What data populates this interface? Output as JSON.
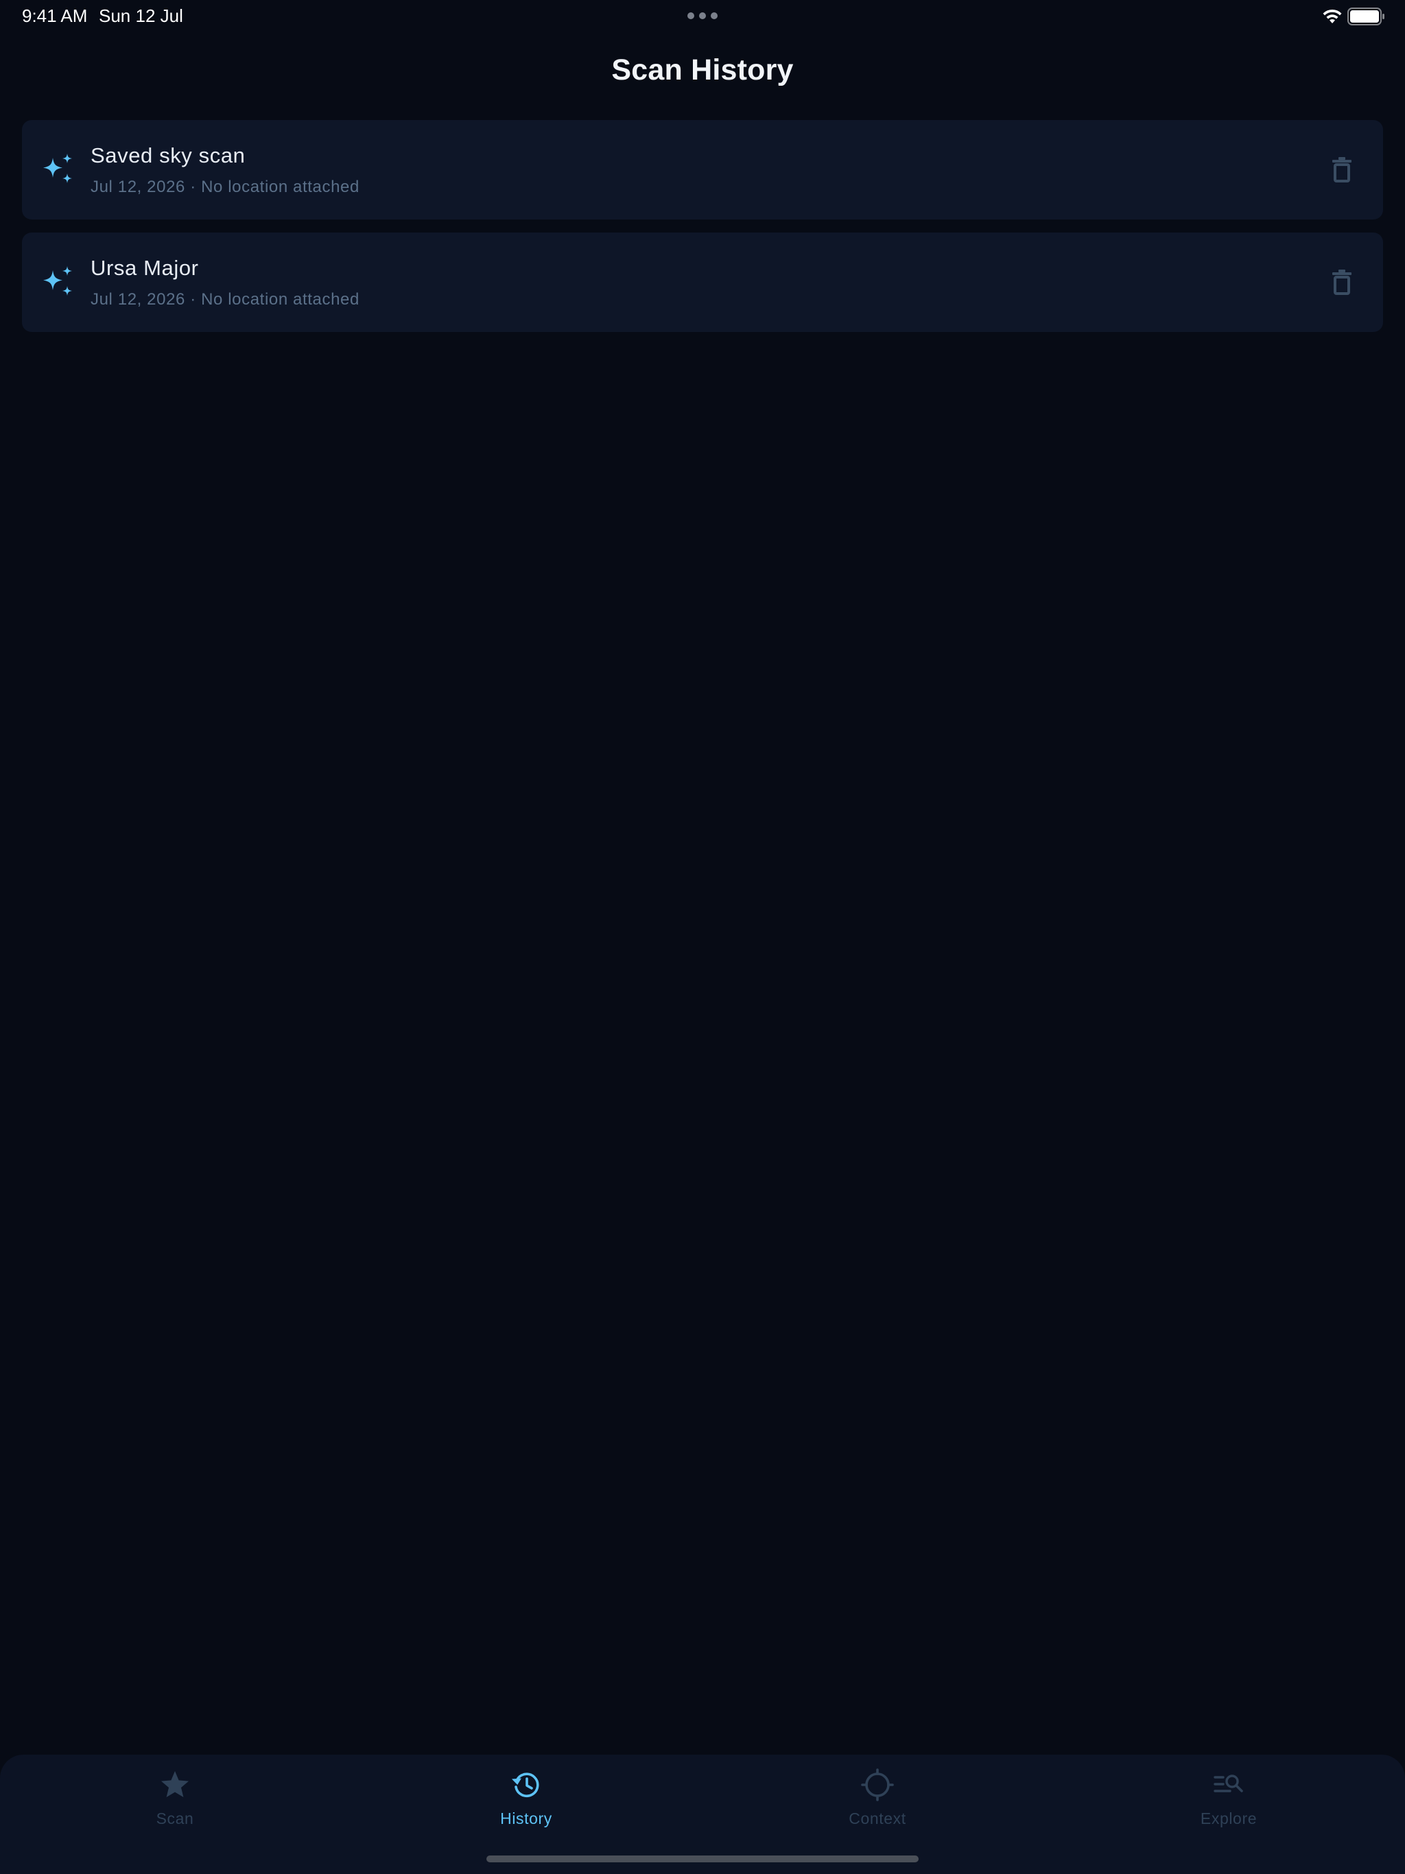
{
  "status_bar": {
    "time": "9:41 AM",
    "date": "Sun 12 Jul",
    "wifi_icon": "wifi-icon",
    "battery_icon": "battery-icon"
  },
  "header": {
    "title": "Scan History"
  },
  "history": {
    "items": [
      {
        "title": "Saved sky scan",
        "subtitle": "Jul 12, 2026 · No location attached",
        "icon": "sparkles-icon",
        "action_icon": "trash-icon"
      },
      {
        "title": "Ursa Major",
        "subtitle": "Jul 12, 2026 · No location attached",
        "icon": "sparkles-icon",
        "action_icon": "trash-icon"
      }
    ]
  },
  "tab_bar": {
    "active": "History",
    "tabs": [
      {
        "label": "Scan",
        "icon": "star-icon"
      },
      {
        "label": "History",
        "icon": "history-icon"
      },
      {
        "label": "Context",
        "icon": "crosshair-icon"
      },
      {
        "label": "Explore",
        "icon": "search-list-icon"
      }
    ]
  },
  "colors": {
    "background": "#070b15",
    "card": "#0e1628",
    "accent": "#5ec3f6",
    "muted_text": "#5b7089",
    "inactive_icon": "#2f4157"
  }
}
